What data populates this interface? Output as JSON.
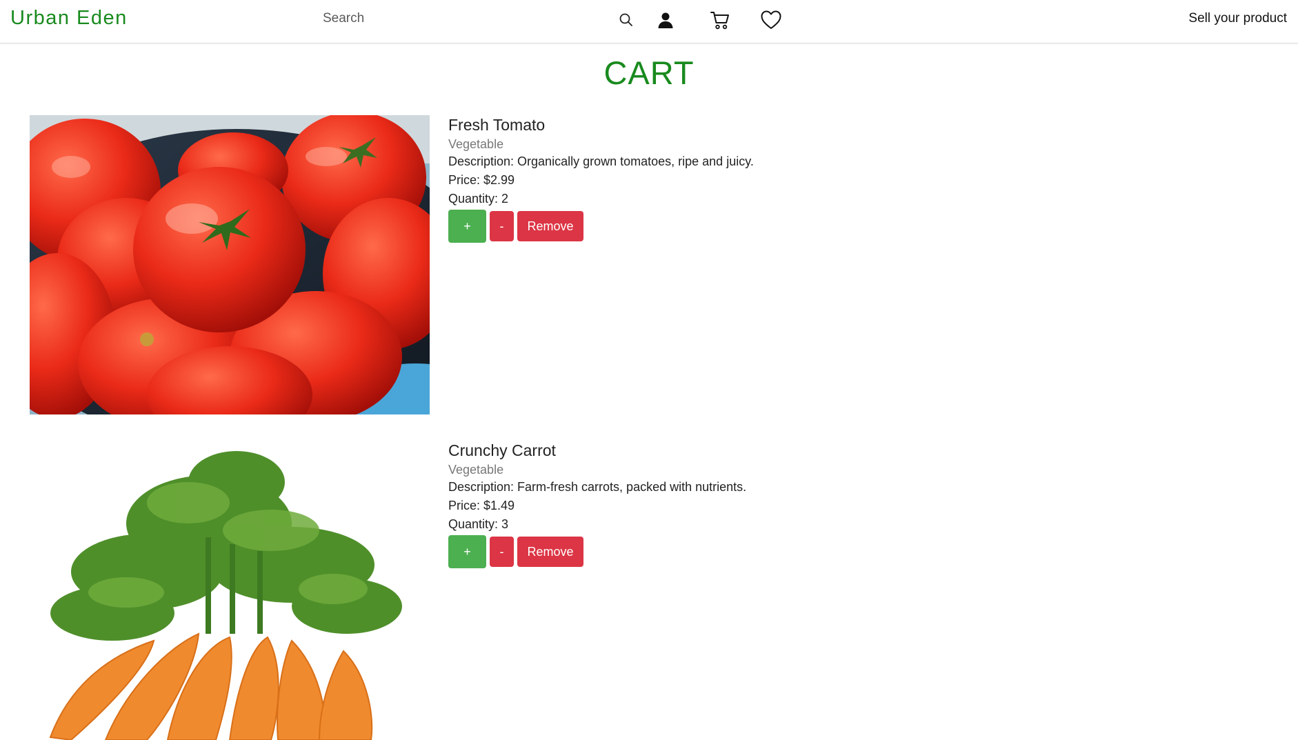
{
  "header": {
    "brand": "Urban Eden",
    "search_placeholder": "Search",
    "icons": [
      "search-icon",
      "user-icon",
      "cart-icon",
      "heart-icon"
    ],
    "sell_link": "Sell your product"
  },
  "page": {
    "title": "CART"
  },
  "cart": {
    "items": [
      {
        "name": "Fresh Tomato",
        "category": "Vegetable",
        "description": "Description: Organically grown tomatoes, ripe and juicy.",
        "price": "Price: $2.99",
        "quantity": "Quantity: 2",
        "plus_label": "+",
        "minus_label": "-",
        "remove_label": "Remove",
        "image": "tomato-photo"
      },
      {
        "name": "Crunchy Carrot",
        "category": "Vegetable",
        "description": "Description: Farm-fresh carrots, packed with nutrients.",
        "price": "Price: $1.49",
        "quantity": "Quantity: 3",
        "plus_label": "+",
        "minus_label": "-",
        "remove_label": "Remove",
        "image": "carrot-photo"
      }
    ]
  },
  "colors": {
    "brand": "#198a1e",
    "plus_button": "#4caf50",
    "danger_button": "#dc3545"
  }
}
